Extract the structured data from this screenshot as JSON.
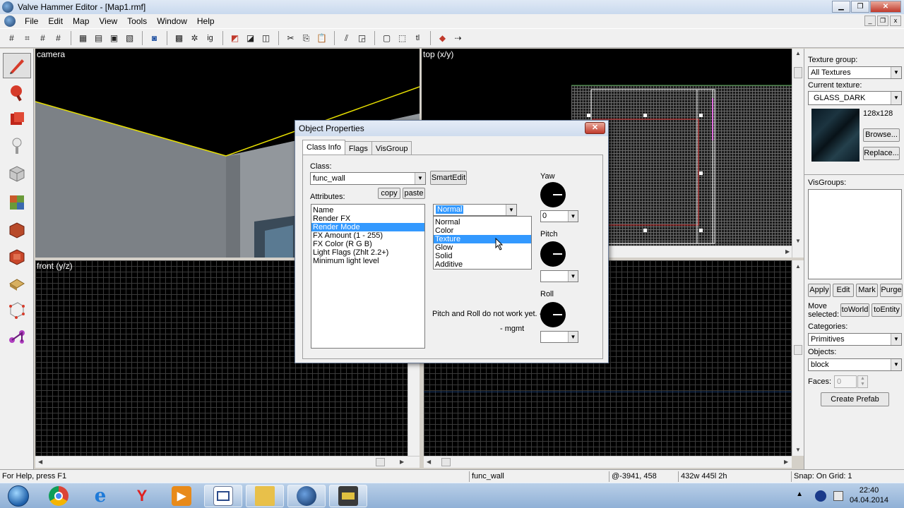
{
  "window": {
    "title": "Valve Hammer Editor - [Map1.rmf]"
  },
  "menu": {
    "items": [
      "File",
      "Edit",
      "Map",
      "View",
      "Tools",
      "Window",
      "Help"
    ]
  },
  "toolbar": {
    "buttons": [
      "grid-icon",
      "grid-lines-icon",
      "grid-dense-icon",
      "grid-small-icon",
      "group-icon",
      "ungroup-icon",
      "hide-icon",
      "carve-icon",
      "texture-lock-icon",
      "ignore-groups-icon",
      "cordon-icon",
      "cordon-toggle-icon",
      "cordon-edit-icon",
      "cut-icon",
      "copy-icon",
      "paste-icon",
      "texture-app-icon",
      "texture-app-face-icon",
      "select-box-icon",
      "selection-icon",
      "text-icon",
      "vertex-icon",
      "run-map-icon"
    ]
  },
  "viewports": {
    "camera_label": "camera",
    "top_label": "top (x/y)",
    "front_label": "front (y/z)"
  },
  "dialog": {
    "title": "Object Properties",
    "tabs": [
      "Class Info",
      "Flags",
      "VisGroup"
    ],
    "class_label": "Class:",
    "class_value": "func_wall",
    "smartedit_label": "SmartEdit",
    "attributes_label": "Attributes:",
    "copy_label": "copy",
    "paste_label": "paste",
    "attributes": [
      "Name",
      "Render FX",
      "Render Mode",
      "FX Amount (1 - 255)",
      "FX Color (R G B)",
      "Light Flags (Zhlt 2.2+)",
      "Minimum light level"
    ],
    "selected_attribute_index": 2,
    "render_mode_value": "Normal",
    "render_mode_options": [
      "Normal",
      "Color",
      "Texture",
      "Glow",
      "Solid",
      "Additive"
    ],
    "highlighted_option_index": 2,
    "yaw_label": "Yaw",
    "yaw_value": "0",
    "pitch_label": "Pitch",
    "roll_label": "Roll",
    "note_line1": "Pitch and Roll do not work yet. ->",
    "note_line2": "- mgmt"
  },
  "right_panel": {
    "texture_group_label": "Texture group:",
    "texture_group_value": "All Textures",
    "current_texture_label": "Current texture:",
    "current_texture_value": "GLASS_DARK",
    "texture_size": "128x128",
    "browse_label": "Browse...",
    "replace_label": "Replace...",
    "visgroups_label": "VisGroups:",
    "apply_label": "Apply",
    "edit_label": "Edit",
    "mark_label": "Mark",
    "purge_label": "Purge",
    "move_selected_line1": "Move",
    "move_selected_line2": "selected:",
    "toworld_label": "toWorld",
    "toentity_label": "toEntity",
    "categories_label": "Categories:",
    "categories_value": "Primitives",
    "objects_label": "Objects:",
    "objects_value": "block",
    "faces_label": "Faces:",
    "faces_value": "0",
    "create_prefab_label": "Create Prefab"
  },
  "status": {
    "help": "For Help, press F1",
    "selection": "func_wall",
    "coords": "@-3941, 458",
    "size": "432w 445l 2h",
    "snap": "Snap: On Grid: 1"
  },
  "taskbar": {
    "apps": [
      "chrome-icon",
      "internet-explorer-icon",
      "yandex-icon",
      "media-player-icon",
      "hammer-doc-icon",
      "file-explorer-icon",
      "hammer-app-icon",
      "hypercam-icon"
    ],
    "time": "22:40",
    "date": "04.04.2014"
  }
}
